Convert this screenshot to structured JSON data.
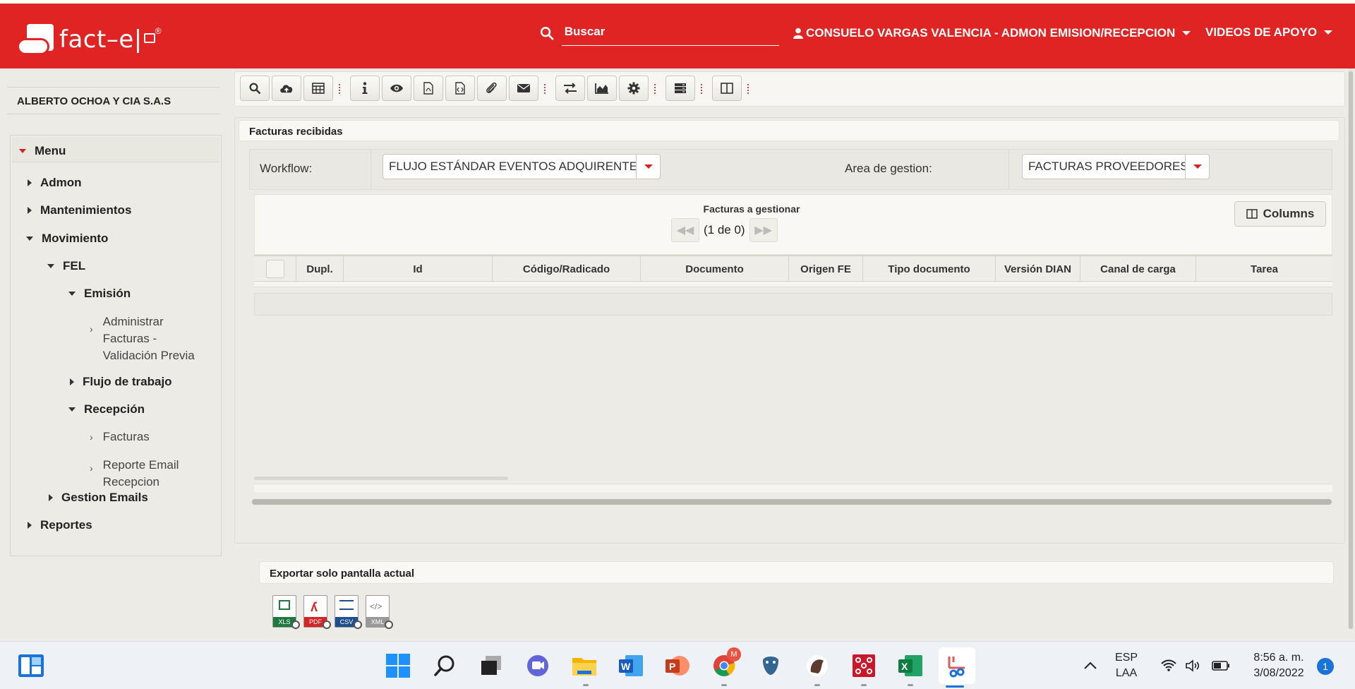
{
  "header": {
    "logo_text": "fact–e|",
    "logo_reg": "®",
    "search_placeholder": "Buscar",
    "user_label": "CONSUELO VARGAS VALENCIA - ADMON EMISION/RECEPCION",
    "videos_label": "VIDEOS DE APOYO"
  },
  "sidebar": {
    "company": "ALBERTO OCHOA Y CIA S.A.S",
    "menu_title": "Menu",
    "items": {
      "admon": "Admon",
      "mantenimientos": "Mantenimientos",
      "movimiento": "Movimiento",
      "fel": "FEL",
      "emision": "Emisión",
      "administrar": [
        "Administrar",
        "Facturas -",
        "Validación Previa"
      ],
      "flujo": "Flujo de trabajo",
      "recepcion": "Recepción",
      "facturas": "Facturas",
      "reporte_email": [
        "Reporte Email",
        "Recepcion"
      ],
      "gestion_emails": "Gestion Emails",
      "reportes": "Reportes"
    }
  },
  "toolbar": {
    "buttons": [
      "search-icon",
      "cloud-upload-icon",
      "table-icon",
      "info-icon",
      "eye-icon",
      "pdf-icon",
      "code-file-icon",
      "paperclip-icon",
      "envelope-icon",
      "exchange-icon",
      "area-chart-icon",
      "gear-icon",
      "server-icon",
      "columns-icon"
    ]
  },
  "panel": {
    "title": "Facturas recibidas",
    "workflow_label": "Workflow:",
    "workflow_value": "FLUJO ESTÁNDAR EVENTOS ADQUIRENTE",
    "area_label": "Area de gestion:",
    "area_value": "FACTURAS PROVEEDORES",
    "grid_caption": "Facturas a gestionar",
    "pager_text": "(1 de 0)",
    "columns_button": "Columns",
    "columns": [
      "Dupl.",
      "Id",
      "Código/Radicado",
      "Documento",
      "Origen FE",
      "Tipo documento",
      "Versión DIAN",
      "Canal de carga",
      "Tarea"
    ]
  },
  "export": {
    "title": "Exportar solo pantalla actual",
    "formats": [
      "XLS",
      "PDF",
      "CSV",
      "XML"
    ]
  },
  "taskbar": {
    "lang_1": "ESP",
    "lang_2": "LAA",
    "time": "8:56 a. m.",
    "date": "3/08/2022",
    "notification_count": "1",
    "chrome_badge": "M"
  },
  "colors": {
    "brand_red": "#e02424",
    "background": "#ecebe5"
  }
}
